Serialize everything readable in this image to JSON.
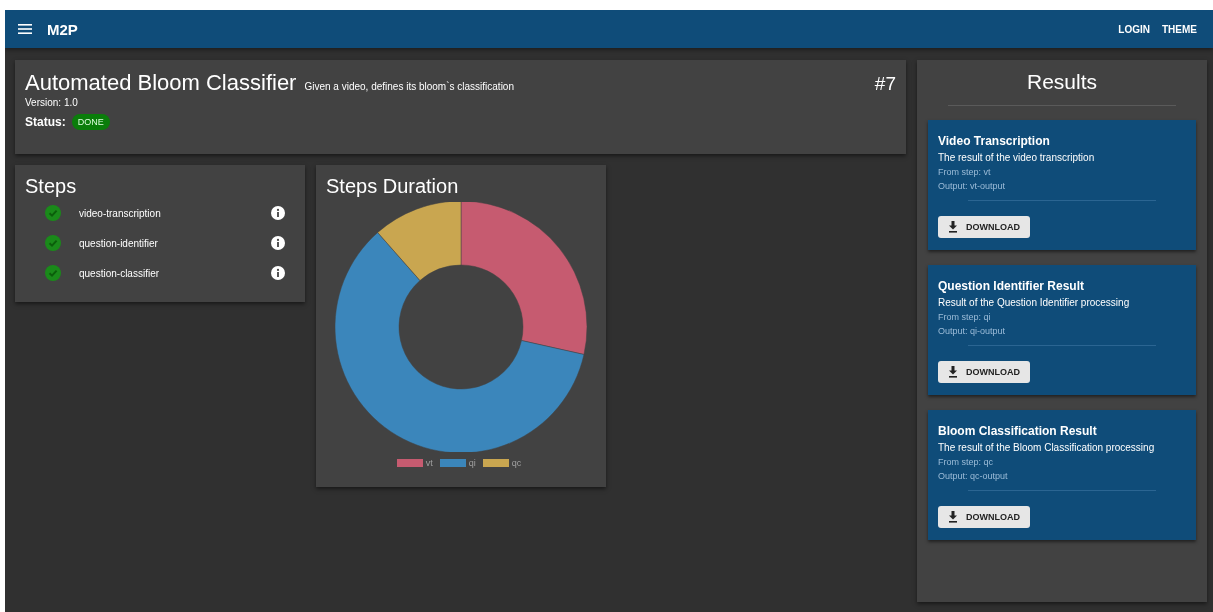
{
  "app_bar": {
    "title": "M2P",
    "actions": [
      "LOGIN",
      "THEME"
    ]
  },
  "header": {
    "title": "Automated Bloom Classifier",
    "description": "Given a video, defines its bloom`s classification",
    "version": "Version: 1.0",
    "status_label": "Status:",
    "status": "DONE",
    "number": "#7"
  },
  "steps": {
    "title": "Steps",
    "items": [
      {
        "name": "video-transcription",
        "done": true
      },
      {
        "name": "question-identifier",
        "done": true
      },
      {
        "name": "question-classifier",
        "done": true
      }
    ]
  },
  "duration": {
    "title": "Steps Duration",
    "legend": [
      {
        "label": "vt",
        "color": "#c65b70"
      },
      {
        "label": "qi",
        "color": "#3b86bb"
      },
      {
        "label": "qc",
        "color": "#c9a650"
      }
    ]
  },
  "results": {
    "title": "Results",
    "items": [
      {
        "title": "Video Transcription",
        "description": "The result of the video transcription",
        "from": "From step: vt",
        "output": "Output: vt-output",
        "button": "DOWNLOAD"
      },
      {
        "title": "Question Identifier Result",
        "description": "Result of the Question Identifier processing",
        "from": "From step: qi",
        "output": "Output: qi-output",
        "button": "DOWNLOAD"
      },
      {
        "title": "Bloom Classification Result",
        "description": "The result of the Bloom Classification processing",
        "from": "From step: qc",
        "output": "Output: qc-output",
        "button": "DOWNLOAD"
      }
    ]
  }
}
